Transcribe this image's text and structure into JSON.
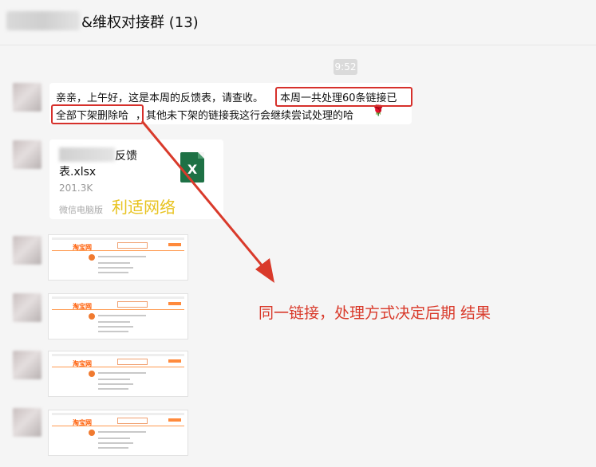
{
  "header": {
    "title": "&维权对接群 (13)"
  },
  "time": "9:52",
  "message": {
    "line1_pre": "亲亲，上午好，这是本周的反馈表，请查收。",
    "line1_hl": "本周一共处理60条链接已",
    "line2_hl": "全部下架删除哈",
    "line2_post": "，其他未下架的链接我这行会继续尝试处理的哈",
    "emoji": "🌹"
  },
  "file": {
    "name_part1": "反馈",
    "name_part2": "表.xlsx",
    "size": "201.3K",
    "source": "微信电脑版",
    "icon_letter": "X"
  },
  "watermark": "利适网络",
  "annotation": "同一链接，处理方式决定后期 结果",
  "thumbnail": {
    "logo": "淘宝网"
  },
  "colors": {
    "annotation": "#d93a2b",
    "highlight_box": "#d6302b",
    "excel": "#1e7145",
    "watermark": "#e8c320"
  }
}
